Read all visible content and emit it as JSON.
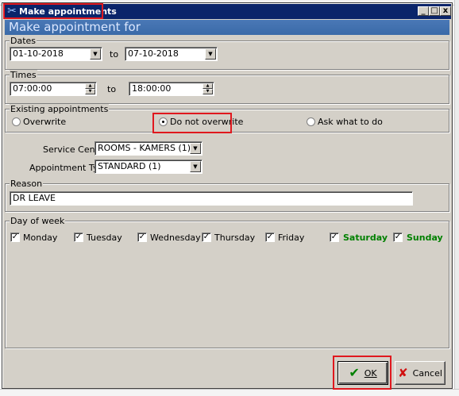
{
  "window": {
    "title": "Make appointments",
    "header": "Make appointment for",
    "controls": {
      "minimize": "_",
      "maximize": "□",
      "close": "x"
    }
  },
  "dates": {
    "legend": "Dates",
    "from": "01-10-2018",
    "to_label": "to",
    "to": "07-10-2018"
  },
  "times": {
    "legend": "Times",
    "from": "07:00:00",
    "to_label": "to",
    "to": "18:00:00"
  },
  "existing": {
    "legend": "Existing appointments",
    "options": [
      "Overwrite",
      "Do not overwrite",
      "Ask what to do"
    ],
    "selected": "Do not overwrite"
  },
  "service": {
    "centre_label": "Service Centre:",
    "centre_value": "ROOMS - KAMERS (1)",
    "type_label": "Appointment Type:",
    "type_value": "STANDARD (1)"
  },
  "reason": {
    "legend": "Reason",
    "value": "DR LEAVE"
  },
  "days": {
    "legend": "Day of week",
    "items": [
      {
        "label": "Monday",
        "checked": true
      },
      {
        "label": "Tuesday",
        "checked": true
      },
      {
        "label": "Wednesday",
        "checked": true
      },
      {
        "label": "Thursday",
        "checked": true
      },
      {
        "label": "Friday",
        "checked": true
      },
      {
        "label": "Saturday",
        "checked": true,
        "color": "#008000"
      },
      {
        "label": "Sunday",
        "checked": true,
        "color": "#008000"
      }
    ]
  },
  "buttons": {
    "ok_label": "OK",
    "cancel_label": "Cancel"
  },
  "icons": {
    "app": "scissors-icon",
    "ok": "check-icon",
    "cancel": "x-icon"
  },
  "colors": {
    "titlebar": "#0a246a",
    "header_band": "#3a6aa8",
    "dialog_bg": "#d4d0c8",
    "highlight": "#e0181e",
    "weekend": "#008000"
  }
}
